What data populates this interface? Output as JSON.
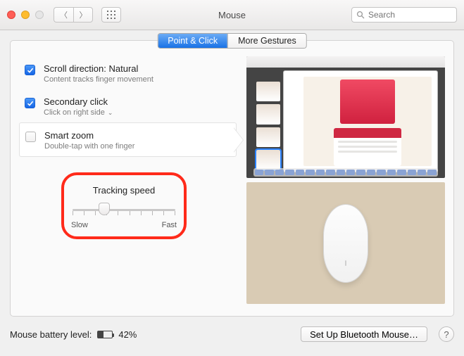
{
  "window": {
    "title": "Mouse"
  },
  "toolbar": {
    "search_placeholder": "Search"
  },
  "tabs": {
    "point_click": "Point & Click",
    "more_gestures": "More Gestures"
  },
  "options": {
    "scroll": {
      "title": "Scroll direction: Natural",
      "sub": "Content tracks finger movement",
      "checked": true
    },
    "secondary": {
      "title": "Secondary click",
      "sub": "Click on right side",
      "checked": true
    },
    "smartzoom": {
      "title": "Smart zoom",
      "sub": "Double-tap with one finger",
      "checked": false
    }
  },
  "tracking": {
    "label": "Tracking speed",
    "slow": "Slow",
    "fast": "Fast"
  },
  "footer": {
    "battery_label": "Mouse battery level:",
    "battery_pct": "42%",
    "setup_button": "Set Up Bluetooth Mouse…",
    "help": "?"
  }
}
